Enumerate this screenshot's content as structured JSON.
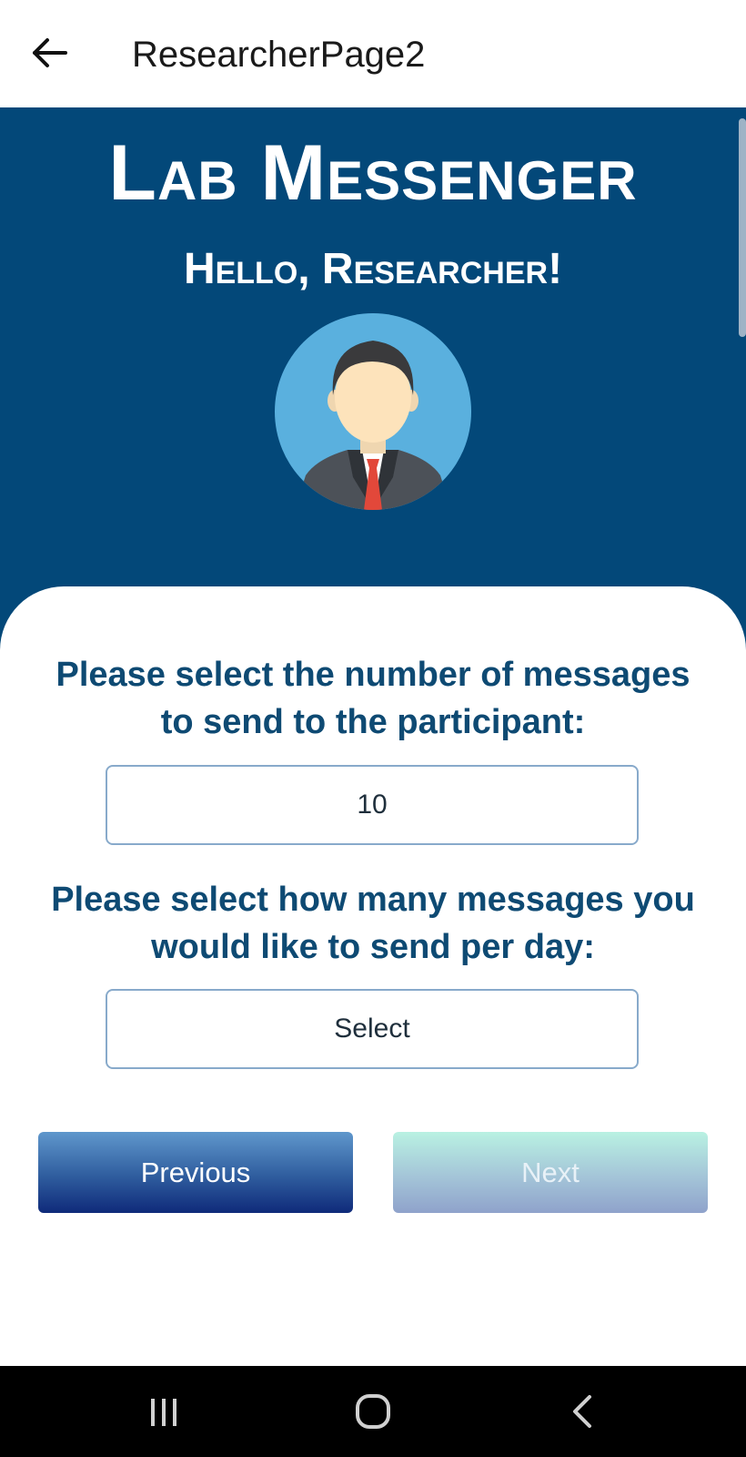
{
  "appbar": {
    "title": "ResearcherPage2",
    "back_icon": "arrow-left-icon"
  },
  "header": {
    "app_title": "Lab Messenger",
    "greeting": "Hello, Researcher!",
    "avatar_icon": "researcher-avatar-icon"
  },
  "form": {
    "messages_total_label": "Please select the number of messages to send to the participant:",
    "messages_total_value": "10",
    "messages_per_day_label": "Please select how many messages you would like to send per day:",
    "messages_per_day_value": "Select"
  },
  "buttons": {
    "previous_label": "Previous",
    "next_label": "Next"
  },
  "navbar": {
    "recents_icon": "recents-icon",
    "home_icon": "home-icon",
    "back_icon": "back-chevron-icon"
  },
  "colors": {
    "header_bg": "#034879",
    "prompt_text": "#0e4a73",
    "field_border": "#88aacb"
  }
}
